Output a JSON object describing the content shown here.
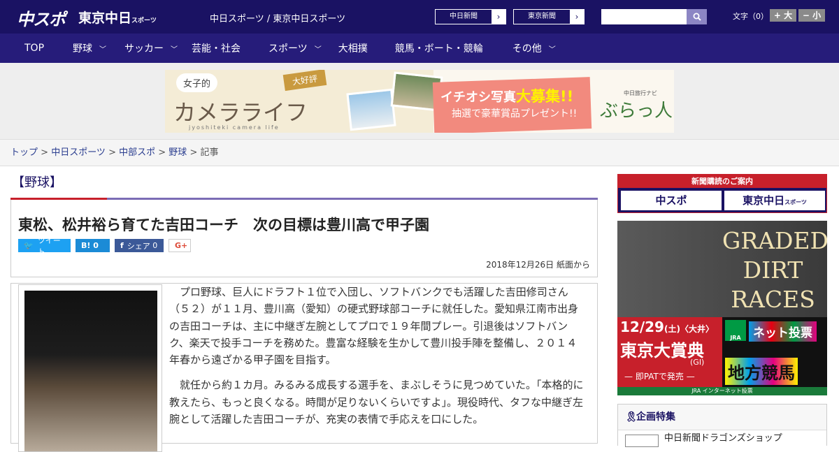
{
  "header": {
    "logo_chunichi": "中スポ",
    "logo_tokyo": "東京中日",
    "logo_tokyo_small": "スポーツ",
    "site_name": "中日スポーツ / 東京中日スポーツ",
    "btn_chunichi": "中日新聞",
    "btn_tokyo": "東京新聞",
    "font_size_label": "文字（0）",
    "font_up": "+ 大",
    "font_down": "− 小"
  },
  "nav": [
    "TOP",
    "野球",
    "サッカー",
    "芸能・社会",
    "スポーツ",
    "大相撲",
    "競馬・ボート・競輪",
    "その他"
  ],
  "banner": {
    "badge": "女子的",
    "title": "カメラライフ",
    "subtitle": "jyoshiteki camera life",
    "tag": "大好評",
    "headline1": "イチオシ写真",
    "headline2": "大募集!!",
    "sub": "抽選で豪華賞品プレゼント!!",
    "brand_small": "中日旅行ナビ",
    "brand": "ぶらっ人"
  },
  "breadcrumb": [
    "トップ",
    "中日スポーツ",
    "中部スポ",
    "野球",
    "記事"
  ],
  "article": {
    "category": "【野球】",
    "title": "東松、松井裕ら育てた吉田コーチ　次の目標は豊川高で甲子園",
    "tweet": "ツイート",
    "hatena": "B!",
    "hatena_count": "0",
    "share": "シェア",
    "share_count": "0",
    "gplus": "G+",
    "date": "2018年12月26日 紙面から",
    "paragraphs": [
      "プロ野球、巨人にドラフト１位で入団し、ソフトバンクでも活躍した吉田修司さん（５２）が１１月、豊川高（愛知）の硬式野球部コーチに就任した。愛知県江南市出身の吉田コーチは、主に中継ぎ左腕としてプロで１９年間プレー。引退後はソフトバンク、楽天で投手コーチを務めた。豊富な経験を生かして豊川投手陣を整備し、２０１４年春から遠ざかる甲子園を目指す。",
      "就任から約１カ月。みるみる成長する選手を、まぶしそうに見つめていた。「本格的に教えたら、もっと良くなる。時間が足りないくらいですよ」。現役時代、タフな中継ぎ左腕として活躍した吉田コーチが、充実の表情で手応えを口にした。"
    ]
  },
  "sidebar": {
    "sub_header": "新聞購読のご案内",
    "sub_btn1": "中スポ",
    "sub_btn2": "東京中日",
    "sub_btn2_small": "スポーツ",
    "ad_title": [
      "GRADED",
      "DIRT",
      "RACES"
    ],
    "ad_date": "12/29",
    "ad_date_sub": "(土)〈大井〉",
    "ad_race": "東京大賞典",
    "ad_grade": "(GI)",
    "ad_pat": "— 即PATで発売 —",
    "ad_net": "ネット投票",
    "ad_local": "地方競馬",
    "ad_jra": "JRA",
    "ad_footer": "JRA インターネット投票",
    "kikaku": "企画特集",
    "kikaku_item": "中日新聞ドラゴンズショップ"
  }
}
